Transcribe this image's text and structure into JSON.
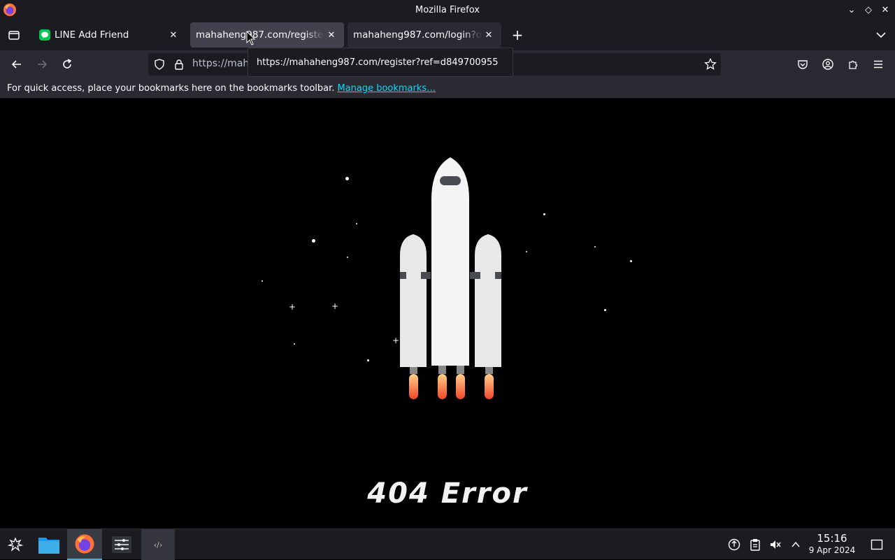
{
  "window": {
    "title": "Mozilla Firefox"
  },
  "tabs": [
    {
      "title": "LINE Add Friend",
      "icon": "line-favicon"
    },
    {
      "title": "mahaheng987.com/register?ref=d849700955",
      "icon": "none"
    },
    {
      "title": "mahaheng987.com/login?op",
      "icon": "none"
    }
  ],
  "tooltip": {
    "text": "https://mahaheng987.com/register?ref=d849700955"
  },
  "urlbar": {
    "value": "https://mah"
  },
  "bookmarks_bar": {
    "message": "For quick access, place your bookmarks here on the bookmarks toolbar.",
    "link": "Manage bookmarks…"
  },
  "page": {
    "error_text": "404 Error"
  },
  "taskbar": {
    "clock_time": "15:16",
    "clock_date": "9 Apr 2024"
  },
  "colors": {
    "accent_link": "#00ddff",
    "line_green": "#06c755",
    "flame": "#f25c2a"
  }
}
